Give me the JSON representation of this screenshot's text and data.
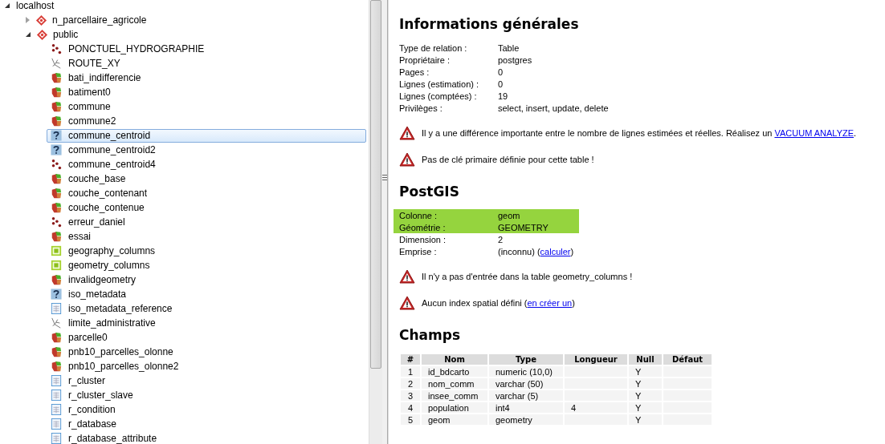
{
  "tree": [
    {
      "label": "localhost",
      "expanded": true,
      "children": [
        {
          "label": "n_parcellaire_agricole",
          "kind": "schema",
          "expanded": false
        },
        {
          "label": "public",
          "kind": "schema",
          "expanded": true,
          "children": [
            {
              "label": "PONCTUEL_HYDROGRAPHIE",
              "kind": "point",
              "selected": false
            },
            {
              "label": "ROUTE_XY",
              "kind": "line",
              "selected": false
            },
            {
              "label": "bati_indifferencie",
              "kind": "polygon",
              "selected": false
            },
            {
              "label": "batiment0",
              "kind": "polygon",
              "selected": false
            },
            {
              "label": "commune",
              "kind": "polygon",
              "selected": false
            },
            {
              "label": "commune2",
              "kind": "polygon",
              "selected": false
            },
            {
              "label": "commune_centroid",
              "kind": "unknown",
              "selected": true
            },
            {
              "label": "commune_centroid2",
              "kind": "unknown",
              "selected": false
            },
            {
              "label": "commune_centroid4",
              "kind": "point",
              "selected": false
            },
            {
              "label": "couche_base",
              "kind": "polygon",
              "selected": false
            },
            {
              "label": "couche_contenant",
              "kind": "polygon",
              "selected": false
            },
            {
              "label": "couche_contenue",
              "kind": "polygon",
              "selected": false
            },
            {
              "label": "erreur_daniel",
              "kind": "point",
              "selected": false
            },
            {
              "label": "essai",
              "kind": "polygon",
              "selected": false
            },
            {
              "label": "geography_columns",
              "kind": "view",
              "selected": false
            },
            {
              "label": "geometry_columns",
              "kind": "view",
              "selected": false
            },
            {
              "label": "invalidgeometry",
              "kind": "polygon",
              "selected": false
            },
            {
              "label": "iso_metadata",
              "kind": "unknown",
              "selected": false
            },
            {
              "label": "iso_metadata_reference",
              "kind": "table",
              "selected": false
            },
            {
              "label": "limite_administrative",
              "kind": "line",
              "selected": false
            },
            {
              "label": "parcelle0",
              "kind": "polygon",
              "selected": false
            },
            {
              "label": "pnb10_parcelles_olonne",
              "kind": "polygon",
              "selected": false
            },
            {
              "label": "pnb10_parcelles_olonne2",
              "kind": "polygon",
              "selected": false
            },
            {
              "label": "r_cluster",
              "kind": "table",
              "selected": false
            },
            {
              "label": "r_cluster_slave",
              "kind": "table",
              "selected": false
            },
            {
              "label": "r_condition",
              "kind": "table",
              "selected": false
            },
            {
              "label": "r_database",
              "kind": "table",
              "selected": false
            },
            {
              "label": "r_database_attribute",
              "kind": "table",
              "selected": false
            }
          ]
        }
      ]
    }
  ],
  "general": {
    "title": "Informations générales",
    "rows": [
      {
        "label": "Type de relation :",
        "value": [
          {
            "kind": "text",
            "text": "Table"
          }
        ]
      },
      {
        "label": "Propriétaire :",
        "value": [
          {
            "kind": "text",
            "text": "postgres"
          }
        ]
      },
      {
        "label": "Pages :",
        "value": [
          {
            "kind": "text",
            "text": "0"
          }
        ]
      },
      {
        "label": "Lignes (estimation) :",
        "value": [
          {
            "kind": "text",
            "text": "0"
          }
        ]
      },
      {
        "label": "Lignes (comptées) :",
        "value": [
          {
            "kind": "text",
            "text": "19"
          }
        ]
      },
      {
        "label": "Privilèges :",
        "value": [
          {
            "kind": "text",
            "text": "select, insert, update, delete"
          }
        ]
      }
    ],
    "warnings": [
      [
        {
          "kind": "text",
          "text": "Il y a une différence importante entre le nombre de lignes estimées et réelles. Réalisez un "
        },
        {
          "kind": "link",
          "text": "VACUUM ANALYZE"
        },
        {
          "kind": "text",
          "text": "."
        }
      ],
      [
        {
          "kind": "text",
          "text": "Pas de clé primaire définie pour cette table !"
        }
      ]
    ]
  },
  "postgis": {
    "title": "PostGIS",
    "rows": [
      {
        "label": "Colonne :",
        "highlight": true,
        "value": [
          {
            "kind": "text",
            "text": "geom"
          }
        ]
      },
      {
        "label": "Géométrie :",
        "highlight": true,
        "value": [
          {
            "kind": "text",
            "text": "GEOMETRY"
          }
        ]
      },
      {
        "label": "Dimension :",
        "highlight": false,
        "value": [
          {
            "kind": "text",
            "text": "2"
          }
        ]
      },
      {
        "label": "Emprise :",
        "highlight": false,
        "value": [
          {
            "kind": "text",
            "text": "(inconnu) ("
          },
          {
            "kind": "link",
            "text": "calculer"
          },
          {
            "kind": "text",
            "text": ")"
          }
        ]
      }
    ],
    "warnings": [
      [
        {
          "kind": "text",
          "text": "Il n'y a pas d'entrée dans la table geometry_columns !"
        }
      ],
      [
        {
          "kind": "text",
          "text": "Aucun index spatial défini ("
        },
        {
          "kind": "link",
          "text": "en créer un"
        },
        {
          "kind": "text",
          "text": ")"
        }
      ]
    ]
  },
  "fields": {
    "title": "Champs",
    "columns": [
      "#",
      "Nom",
      "Type",
      "Longueur",
      "Null",
      "Défaut"
    ],
    "rows": [
      [
        "1",
        "id_bdcarto",
        "numeric (10,0)",
        "",
        "Y",
        ""
      ],
      [
        "2",
        "nom_comm",
        "varchar (50)",
        "",
        "Y",
        ""
      ],
      [
        "3",
        "insee_comm",
        "varchar (5)",
        "",
        "Y",
        ""
      ],
      [
        "4",
        "population",
        "int4",
        "4",
        "Y",
        ""
      ],
      [
        "5",
        "geom",
        "geometry",
        "",
        "Y",
        ""
      ]
    ]
  }
}
